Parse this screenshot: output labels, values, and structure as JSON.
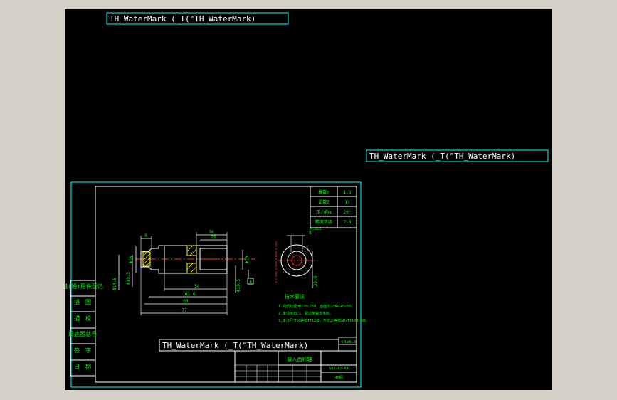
{
  "watermarks": [
    "TH_WaterMark (_T(\"TH_WaterMark)",
    "TH_WaterMark (_T(\"TH_WaterMark)",
    "TH_WaterMark (_T(\"TH_WaterMark)"
  ],
  "left_column": [
    "借(通)用件登记",
    "描　图",
    "描　校",
    "旧底图总号",
    "签　字",
    "日　期"
  ],
  "gear_params": [
    {
      "label": "模数m",
      "value": "1.5"
    },
    {
      "label": "齿数Z",
      "value": "13"
    },
    {
      "label": "压力角α",
      "value": "20°"
    },
    {
      "label": "精度等级",
      "value": "7-8"
    }
  ],
  "dimensions": {
    "top_9": "9",
    "top_30": "30",
    "top_25": "25",
    "left_a": "Φ16",
    "left_b": "Φ14.5",
    "left_c": "Φ19.5",
    "right_a": "Φ20",
    "right_b": "Φ19.5",
    "bottom_58": "58",
    "bottom_618": "61.8",
    "bottom_68": "68",
    "bottom_77": "77",
    "datum": "A",
    "tol": "0.025",
    "side_8": "8",
    "side_336": "33.6"
  },
  "tech_requirements": {
    "title": "技术要求",
    "items": [
      "1.调质处理HB220~250，齿面淬火HRC45~50。",
      "2.未注倒角C1，锐边倒钝去毛刺。",
      "3.未注尺寸公差按IT12级，形位公差按GB/T1184-K级。"
    ]
  },
  "roughness_note": "√Ra6.3",
  "title_block": {
    "part_name": "输入齿轮轴",
    "drawing_no": "SRJ-02-03",
    "material": "45钢"
  }
}
